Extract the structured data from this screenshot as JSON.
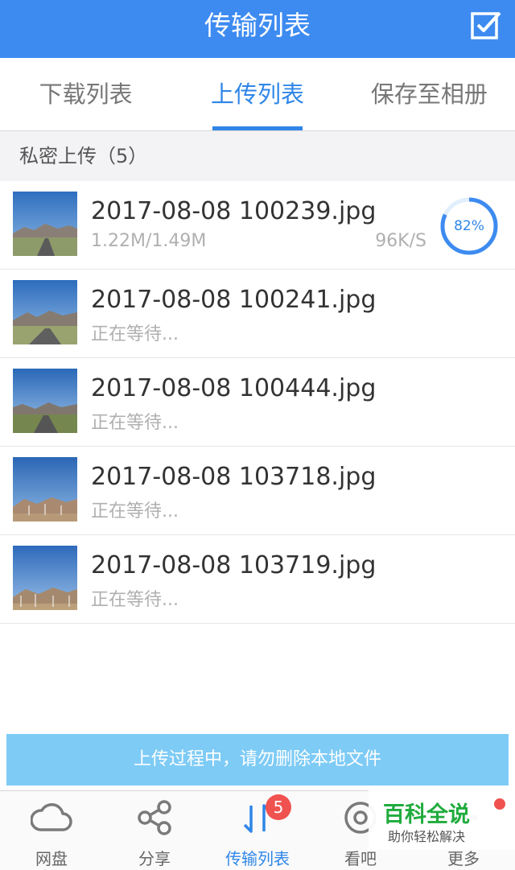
{
  "header": {
    "title": "传输列表",
    "edit_icon": "checkbox-edit-icon"
  },
  "tabs": [
    {
      "label": "下载列表",
      "active": false
    },
    {
      "label": "上传列表",
      "active": true
    },
    {
      "label": "保存至相册",
      "active": false
    }
  ],
  "section": {
    "label": "私密上传（5）"
  },
  "items": [
    {
      "name": "2017-08-08 100239.jpg",
      "status": "1.22M/1.49M",
      "speed": "96K/S",
      "progress_label": "82%",
      "progress": 0.82
    },
    {
      "name": "2017-08-08 100241.jpg",
      "status": "正在等待..."
    },
    {
      "name": "2017-08-08 100444.jpg",
      "status": "正在等待..."
    },
    {
      "name": "2017-08-08 103718.jpg",
      "status": "正在等待..."
    },
    {
      "name": "2017-08-08 103719.jpg",
      "status": "正在等待..."
    }
  ],
  "notice": "上传过程中，请勿删除本地文件",
  "bottom_nav": [
    {
      "label": "网盘",
      "icon": "cloud-icon"
    },
    {
      "label": "分享",
      "icon": "share-icon"
    },
    {
      "label": "传输列表",
      "icon": "transfer-icon",
      "badge": "5",
      "active": true
    },
    {
      "label": "看吧",
      "icon": "eye-icon"
    },
    {
      "label": "更多",
      "icon": "more-icon"
    }
  ],
  "watermark": {
    "brand": "百科全说",
    "slogan": "助你轻松解决"
  },
  "colors": {
    "primary": "#3d8bf0",
    "accent": "#2f86e8",
    "notice": "#7ecbf6",
    "badge": "#f0524f",
    "brand": "#1fab3d"
  }
}
